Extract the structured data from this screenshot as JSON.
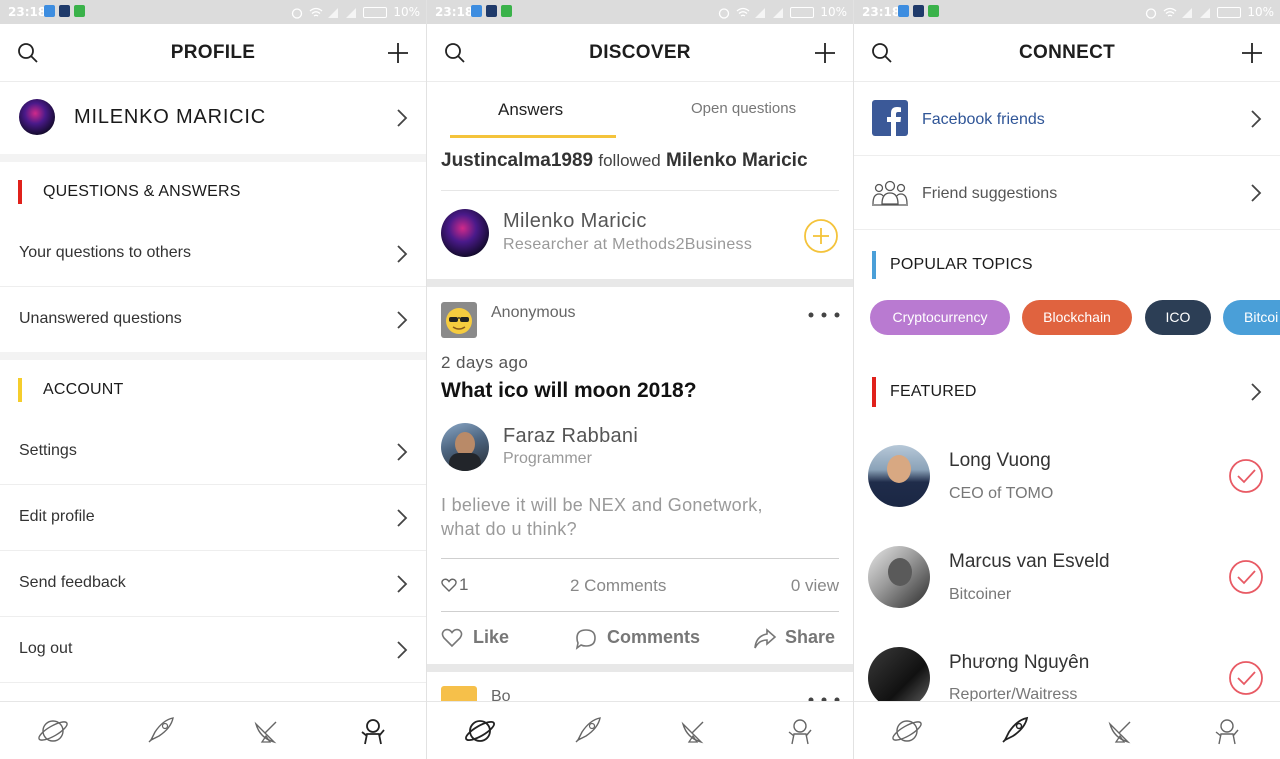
{
  "status": {
    "time": "23:18",
    "battery": "10%"
  },
  "profile": {
    "title": "PROFILE",
    "user_name": "MILENKO MARICIC",
    "sections": [
      {
        "title": "QUESTIONS & ANSWERS",
        "color": "#e0211b",
        "items": [
          "Your questions to others",
          "Unanswered questions"
        ]
      },
      {
        "title": "ACCOUNT",
        "color": "#f5cd2c",
        "items": [
          "Settings",
          "Edit profile",
          "Send feedback",
          "Log out"
        ]
      }
    ]
  },
  "discover": {
    "title": "DISCOVER",
    "tabs": [
      "Answers",
      "Open questions"
    ],
    "activity": {
      "actor": "Justincalma1989",
      "verb": "followed",
      "target": "Milenko Maricic"
    },
    "suggested_user": {
      "name": "Milenko Maricic",
      "subtitle": "Researcher at Methods2Business"
    },
    "post": {
      "author": "Anonymous",
      "time": "2 days ago",
      "question": "What ico will moon 2018?",
      "answerer": {
        "name": "Faraz Rabbani",
        "role": "Programmer"
      },
      "answer": "I believe it will be NEX and Gonetwork, what do u think?",
      "likes_count": "1",
      "comments_count": "2 Comments",
      "views_count": "0 view",
      "actions": [
        "Like",
        "Comments",
        "Share"
      ]
    },
    "next_post_author": "Bo"
  },
  "connect": {
    "title": "CONNECT",
    "facebook_label": "Facebook friends",
    "suggestions_label": "Friend suggestions",
    "popular_title": "POPULAR TOPICS",
    "topics": [
      {
        "label": "Cryptocurrency",
        "color": "#b97ad1"
      },
      {
        "label": "Blockchain",
        "color": "#e0633f"
      },
      {
        "label": "ICO",
        "color": "#2c3e55"
      },
      {
        "label": "Bitcoi",
        "color": "#4a9fd8"
      }
    ],
    "featured_title": "FEATURED",
    "featured": [
      {
        "name": "Long Vuong",
        "role": "CEO of TOMO"
      },
      {
        "name": "Marcus van Esveld",
        "role": "Bitcoiner"
      },
      {
        "name": "Phương Nguyên",
        "role": "Reporter/Waitress"
      }
    ]
  },
  "colors": {
    "accent_yellow": "#f4c33b",
    "accent_red": "#e0211b",
    "accent_blue": "#4a9fd8",
    "facebook_blue": "#3b5998",
    "check_red": "#e85a64"
  }
}
